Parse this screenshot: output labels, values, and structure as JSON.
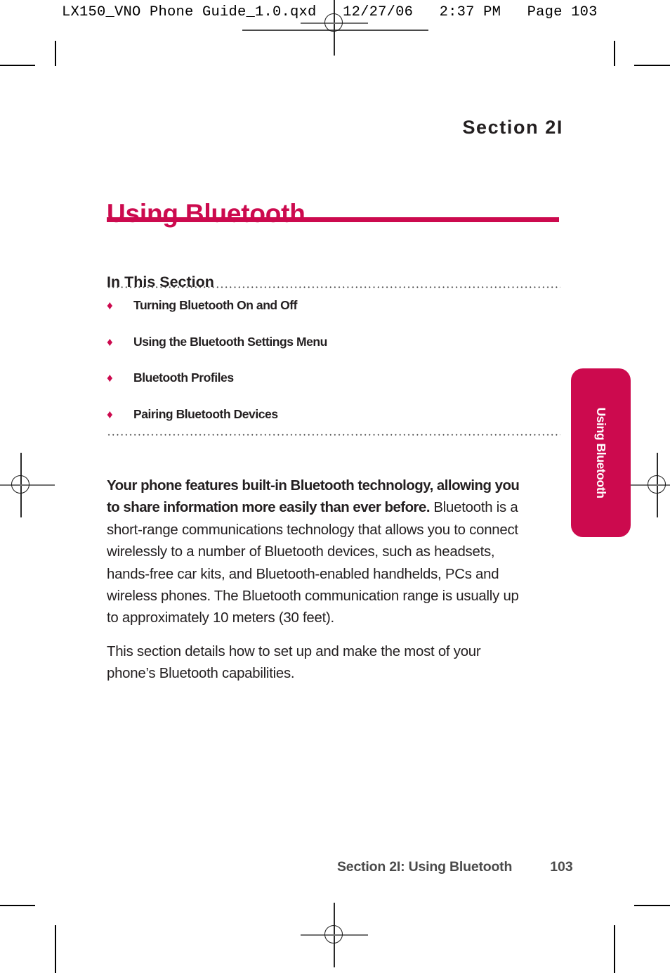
{
  "prepress": {
    "header_line": "LX150_VNO Phone Guide_1.0.qxd   12/27/06   2:37 PM   Page 103"
  },
  "page": {
    "section_eyebrow": "Section 2I",
    "title": "Using Bluetooth",
    "in_this_section_heading": "In This Section",
    "bullet_glyph": "♦",
    "toc": [
      {
        "label": "Turning Bluetooth On and Off"
      },
      {
        "label": "Using the Bluetooth Settings Menu"
      },
      {
        "label": "Bluetooth Profiles"
      },
      {
        "label": "Pairing Bluetooth Devices"
      }
    ],
    "body": {
      "lead": "Your phone features built-in Bluetooth technology, allowing you to share information more easily than ever before.",
      "paragraph_1_rest": " Bluetooth is a short-range communications technology that allows you to connect wirelessly to a number of Bluetooth devices, such as headsets, hands-free car kits, and Bluetooth-enabled handhelds, PCs and wireless phones. The Bluetooth communication range is usually up to approximately 10 meters (30 feet).",
      "paragraph_2": "This section details how to set up and make the most of your phone’s Bluetooth capabilities."
    },
    "side_tab_label": "Using Bluetooth",
    "footer": {
      "label": "Section 2I: Using Bluetooth",
      "page_number": "103"
    }
  },
  "colors": {
    "accent": "#CC0A4E",
    "text": "#231F20",
    "footer_text": "#4B4B4B"
  }
}
